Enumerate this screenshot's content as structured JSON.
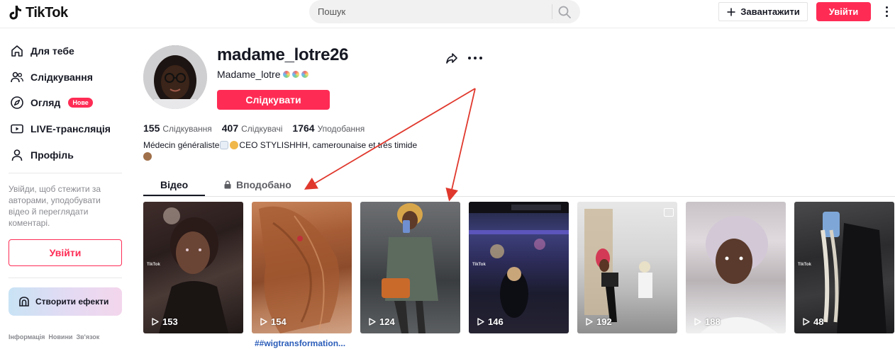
{
  "header": {
    "logo_text": "TikTok",
    "search_placeholder": "Пошук",
    "upload_label": "Завантажити",
    "login_label": "Увійти"
  },
  "sidebar": {
    "items": [
      {
        "label": "Для тебе",
        "icon": "home-icon"
      },
      {
        "label": "Слідкування",
        "icon": "following-icon"
      },
      {
        "label": "Огляд",
        "icon": "compass-icon",
        "badge": "Нове"
      },
      {
        "label": "LIVE-трансляція",
        "icon": "live-icon"
      },
      {
        "label": "Профіль",
        "icon": "profile-icon"
      }
    ],
    "prompt_text": "Увійди, щоб стежити за авторами, уподобувати відео й переглядати коментарі.",
    "login_label": "Увійти",
    "effects_label": "Створити ефекти",
    "footer_links": [
      "Інформація",
      "Новини",
      "Зв'язок"
    ]
  },
  "profile": {
    "username": "madame_lotre26",
    "nickname": "Madame_lotre",
    "follow_label": "Слідкувати",
    "stats": [
      {
        "value": "155",
        "label": "Слідкування"
      },
      {
        "value": "407",
        "label": "Слідкувачі"
      },
      {
        "value": "1764",
        "label": "Уподобання"
      }
    ],
    "bio_a": "Médecin généraliste",
    "bio_b": "CEO STYLISHHH, camerounaise et très timide"
  },
  "tabs": {
    "videos": "Відео",
    "liked": "Вподобано"
  },
  "videos": [
    {
      "views": "153"
    },
    {
      "views": "154"
    },
    {
      "views": "124"
    },
    {
      "views": "146"
    },
    {
      "views": "192"
    },
    {
      "views": "188"
    },
    {
      "views": "48"
    }
  ],
  "caption": "##wigtransformation...",
  "watermark": "TikTok",
  "colors": {
    "brand": "#fe2c55",
    "text": "#161823",
    "annotation": "#e0382d"
  }
}
